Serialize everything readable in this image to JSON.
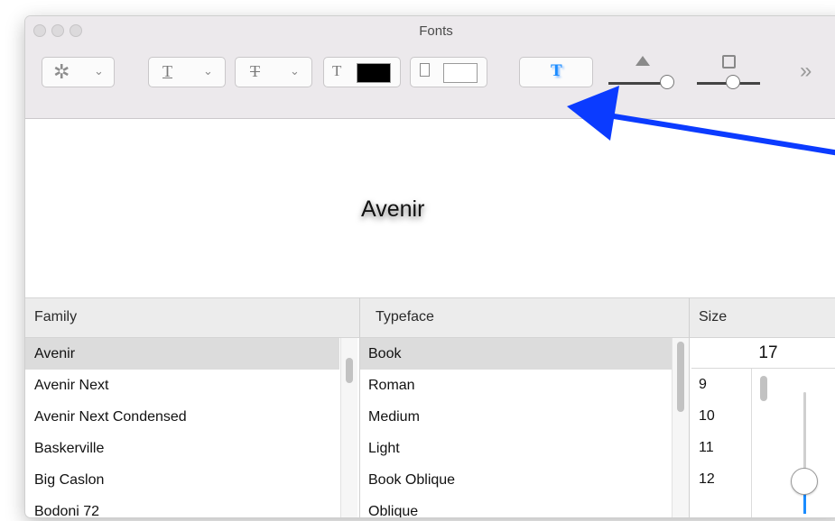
{
  "window": {
    "title": "Fonts"
  },
  "toolbar": {
    "text_color_swatch": "#000000",
    "doc_color_swatch": "#ffffff",
    "overflow_label": "»"
  },
  "preview": {
    "sample_text": "Avenir"
  },
  "columns": {
    "family": "Family",
    "typeface": "Typeface",
    "size": "Size"
  },
  "family_list": [
    {
      "label": "Avenir",
      "selected": true
    },
    {
      "label": "Avenir Next",
      "selected": false
    },
    {
      "label": "Avenir Next Condensed",
      "selected": false
    },
    {
      "label": "Baskerville",
      "selected": false
    },
    {
      "label": "Big Caslon",
      "selected": false
    },
    {
      "label": "Bodoni 72",
      "selected": false
    }
  ],
  "typeface_list": [
    {
      "label": "Book",
      "selected": true
    },
    {
      "label": "Roman",
      "selected": false
    },
    {
      "label": "Medium",
      "selected": false
    },
    {
      "label": "Light",
      "selected": false
    },
    {
      "label": "Book Oblique",
      "selected": false
    },
    {
      "label": "Oblique",
      "selected": false
    }
  ],
  "size": {
    "current_value": "17",
    "options": [
      "9",
      "10",
      "11",
      "12"
    ]
  },
  "colors": {
    "annotation_arrow": "#0b3bff",
    "accent": "#1a8cff"
  }
}
